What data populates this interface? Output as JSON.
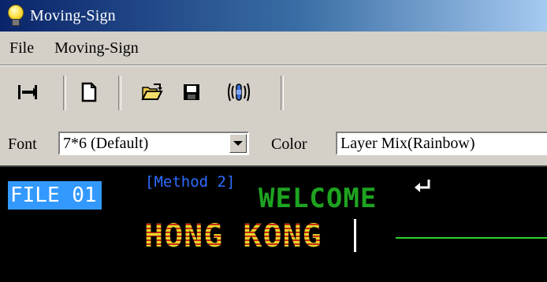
{
  "window": {
    "title": "Moving-Sign",
    "icon": "lightbulb-icon"
  },
  "menu": {
    "items": [
      {
        "label": "File"
      },
      {
        "label": "Moving-Sign"
      }
    ]
  },
  "toolbar": {
    "buttons": [
      {
        "name": "fit-width-icon"
      },
      {
        "name": "new-file-icon"
      },
      {
        "name": "open-folder-icon"
      },
      {
        "name": "save-icon"
      },
      {
        "name": "sound-icon"
      }
    ]
  },
  "fontbar": {
    "font_label": "Font",
    "font_value": "7*6 (Default)",
    "color_label": "Color",
    "color_value": "Layer Mix(Rainbow)"
  },
  "display": {
    "file_label": "FILE 01",
    "method_label": "[Method 2]",
    "line1": "WELCOME",
    "line2": "HONG KONG",
    "colors": {
      "background": "#000000",
      "file_highlight": "#3399ff",
      "method": "#2d6cff",
      "welcome": "#1ea320",
      "line2_yellow": "#e0d92a",
      "line2_red": "#cc2a14",
      "hline": "#2ed12e"
    }
  }
}
